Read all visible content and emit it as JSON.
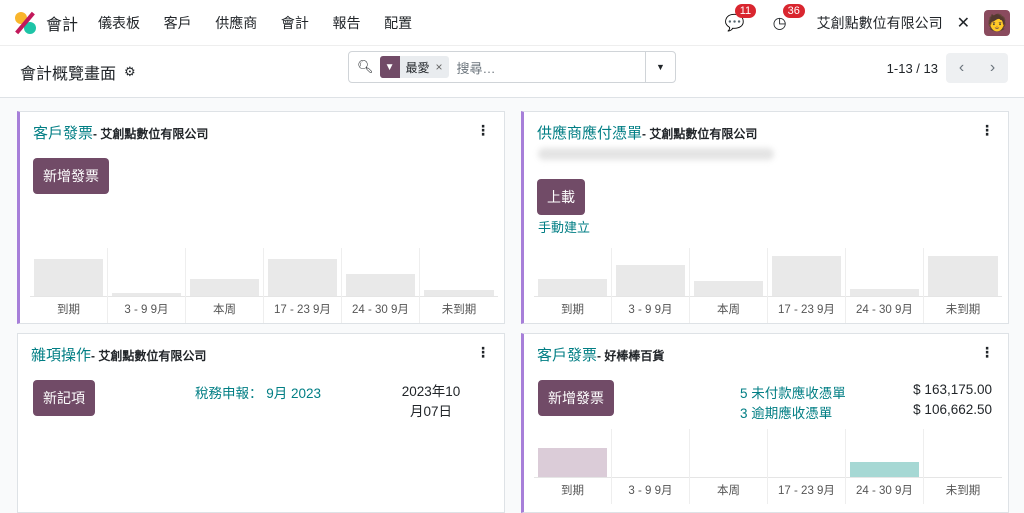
{
  "nav": {
    "app": "會計",
    "menu": [
      "儀表板",
      "客戶",
      "供應商",
      "會計",
      "報告",
      "配置"
    ],
    "messages": "11",
    "activities": "36",
    "company": "艾創點數位有限公司"
  },
  "control": {
    "title": "會計概覽畫面",
    "facet": "最愛",
    "placeholder": "搜尋…",
    "pager": "1-13 / 13"
  },
  "labels": [
    "到期",
    "3 - 9 9月",
    "本周",
    "17 - 23 9月",
    "24 - 30 9月",
    "未到期"
  ],
  "cards": [
    {
      "name": "客戶發票",
      "company": "- 艾創點數位有限公司",
      "button": "新增發票",
      "bars": [
        0.8,
        0.06,
        0.36,
        0.8,
        0.48,
        0.12
      ],
      "colors": [
        "#e9e9e9",
        "#e9e9e9",
        "#e9e9e9",
        "#e9e9e9",
        "#e9e9e9",
        "#e9e9e9"
      ]
    },
    {
      "name": "供應商應付憑單",
      "company": "- 艾創點數位有限公司",
      "button": "上載",
      "link": "手動建立",
      "bars": [
        0.36,
        0.68,
        0.32,
        0.88,
        0.16,
        0.88
      ],
      "colors": [
        "#e9e9e9",
        "#e9e9e9",
        "#e9e9e9",
        "#e9e9e9",
        "#e9e9e9",
        "#e9e9e9"
      ]
    },
    {
      "name": "雜項操作",
      "company": "- 艾創點數位有限公司",
      "button": "新記項",
      "tax": "稅務申報： 9月 2023",
      "date": "2023年10月07日"
    },
    {
      "name": "客戶發票",
      "company": "- 好棒棒百貨",
      "button": "新增發票",
      "rows": [
        {
          "label": "5 未付款應收憑單",
          "amount": "$ 163,175.00"
        },
        {
          "label": "3 逾期應收憑單",
          "amount": "$ 106,662.50"
        }
      ],
      "bars": [
        0.62,
        0,
        0,
        0,
        0.32,
        0
      ],
      "colors": [
        "#dbccd8",
        "#e9e9e9",
        "#e9e9e9",
        "#e9e9e9",
        "#a6d8d4",
        "#e9e9e9"
      ]
    }
  ]
}
